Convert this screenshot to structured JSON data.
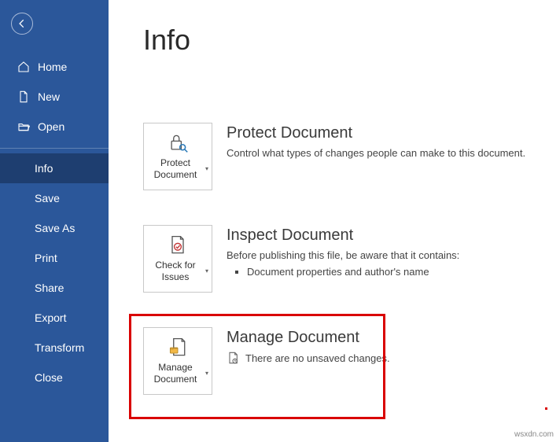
{
  "sidebar": {
    "items": [
      {
        "label": "Home"
      },
      {
        "label": "New"
      },
      {
        "label": "Open"
      },
      {
        "label": "Info"
      },
      {
        "label": "Save"
      },
      {
        "label": "Save As"
      },
      {
        "label": "Print"
      },
      {
        "label": "Share"
      },
      {
        "label": "Export"
      },
      {
        "label": "Transform"
      },
      {
        "label": "Close"
      }
    ]
  },
  "page": {
    "title": "Info"
  },
  "protect": {
    "button_label": "Protect Document",
    "heading": "Protect Document",
    "desc": "Control what types of changes people can make to this document."
  },
  "inspect": {
    "button_label": "Check for Issues",
    "heading": "Inspect Document",
    "desc": "Before publishing this file, be aware that it contains:",
    "item1": "Document properties and author's name"
  },
  "manage": {
    "button_label": "Manage Document",
    "heading": "Manage Document",
    "status": "There are no unsaved changes."
  },
  "watermark": "wsxdn.com"
}
